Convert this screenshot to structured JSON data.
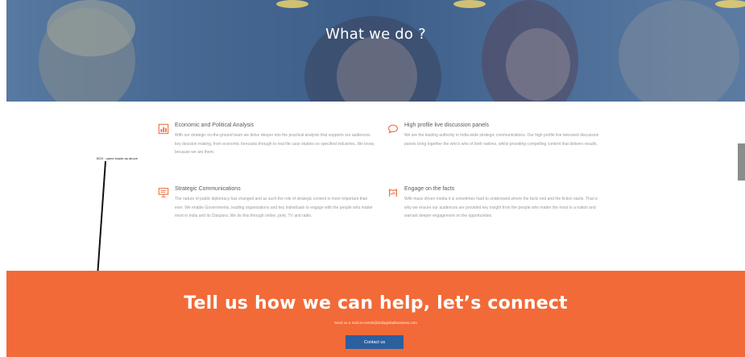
{
  "hero": {
    "title": "What we do ?"
  },
  "annotation": {
    "text": "BOX : same shade as above"
  },
  "services": [
    {
      "icon": "chart-icon",
      "title": "Economic and Political Analysis",
      "text": "With our strategic on-the-ground team we delve deeper into the practical analysis that supports our audiences key decision making, from economic forecasts through to real life case studies on specified industries. We know, because we are there."
    },
    {
      "icon": "speech-bubble-icon",
      "title": "High profile live discussion panels",
      "text": "We are the leading authority in India-wide strategic communications. Our high profile live televised discussion panels bring together the who's who of both nations, whilst providing compelling content that delivers results."
    },
    {
      "icon": "presentation-icon",
      "title": "Strategic Communications",
      "text": "The nature of public diplomacy has changed and as such the role of strategic content is more important than ever. We enable Governments, leading organisations and key individuals to engage with the people who matter most in India and its Diaspora. We do this through online, print, TV and radio."
    },
    {
      "icon": "handshake-icon",
      "title": "Engage on the facts",
      "text": "With mass driven media it is sometimes hard to understand where the facts end and the fiction starts. That is why we ensure our audiences are provided key insight from the people who matter the most to a nation and warrant deeper engagement on the opportunities."
    }
  ],
  "cta": {
    "title": "Tell us how we can help, let’s connect",
    "subtitle": "Send us a mail at events@indiaglobalbusiness.com",
    "button_label": "Contact us"
  },
  "colors": {
    "accent": "#f26a38",
    "button": "#2c5f9e",
    "hero_tint": "#4f6f96"
  }
}
